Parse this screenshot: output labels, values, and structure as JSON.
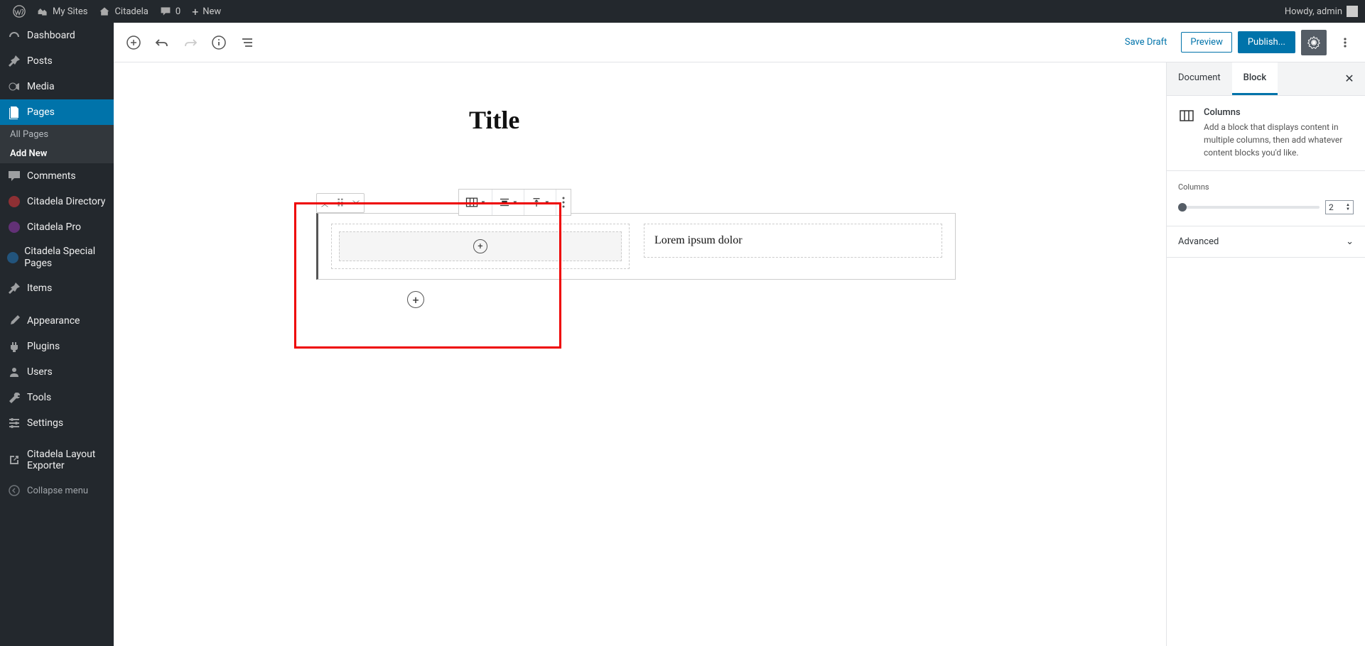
{
  "adminbar": {
    "my_sites": "My Sites",
    "site_name": "Citadela",
    "comment_count": "0",
    "new": "New",
    "howdy": "Howdy, admin"
  },
  "sidebar": {
    "dashboard": "Dashboard",
    "posts": "Posts",
    "media": "Media",
    "pages": "Pages",
    "all_pages": "All Pages",
    "add_new": "Add New",
    "comments": "Comments",
    "citadela_directory": "Citadela Directory",
    "citadela_pro": "Citadela Pro",
    "citadela_special": "Citadela Special Pages",
    "items": "Items",
    "appearance": "Appearance",
    "plugins": "Plugins",
    "users": "Users",
    "tools": "Tools",
    "settings": "Settings",
    "layout_exporter": "Citadela Layout Exporter",
    "collapse": "Collapse menu"
  },
  "header": {
    "save_draft": "Save Draft",
    "preview": "Preview",
    "publish": "Publish..."
  },
  "editor": {
    "title": "Title",
    "column_text": "Lorem ipsum dolor"
  },
  "panel": {
    "tab_document": "Document",
    "tab_block": "Block",
    "block_name": "Columns",
    "block_desc": "Add a block that displays content in multiple columns, then add whatever content blocks you'd like.",
    "columns_label": "Columns",
    "columns_value": "2",
    "advanced": "Advanced"
  }
}
